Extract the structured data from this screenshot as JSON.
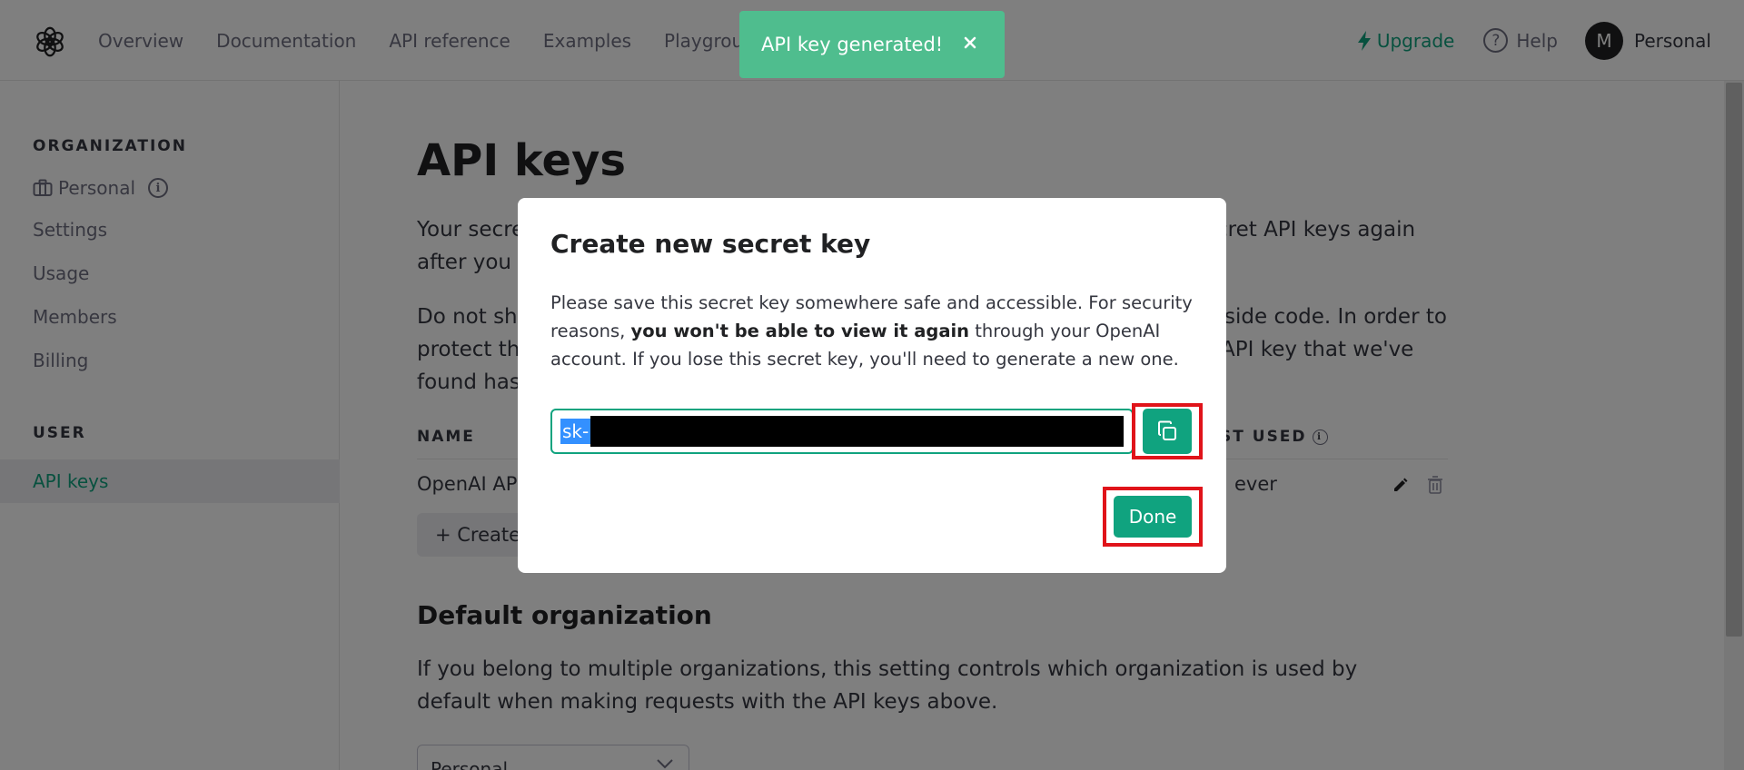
{
  "nav": {
    "links": [
      "Overview",
      "Documentation",
      "API reference",
      "Examples",
      "Playground"
    ],
    "upgrade": "Upgrade",
    "help": "Help",
    "avatar_initial": "M",
    "account": "Personal"
  },
  "sidebar": {
    "organization_heading": "ORGANIZATION",
    "org_name": "Personal",
    "items": [
      "Settings",
      "Usage",
      "Members",
      "Billing"
    ],
    "user_heading": "USER",
    "active_item": "API keys"
  },
  "main": {
    "title": "API keys",
    "para1_start": "Your secre",
    "para1_end": "cret API keys again",
    "para1_line2": "after you g",
    "para2_start": "Do not sha",
    "para2_end": "tside code. In order to",
    "para2_line2_start": "protect th",
    "para2_line2_end": "API key that we've",
    "para2_line3": "found has",
    "col_name": "NAME",
    "col_last_used": "ST USED",
    "row_name": "OpenAI AP",
    "row_last_used": "ever",
    "create_button": "+ Create",
    "default_org_title": "Default organization",
    "default_org_text": "If you belong to multiple organizations, this setting controls which organization is used by default when making requests with the API keys above.",
    "select_value": "Personal"
  },
  "modal": {
    "title": "Create new secret key",
    "body_1": "Please save this secret key somewhere safe and accessible. For security reasons, ",
    "body_bold": "you won't be able to view it again",
    "body_2": " through your OpenAI account. If you lose this secret key, you'll need to generate a new one.",
    "key_prefix": "sk-",
    "done": "Done"
  },
  "toast": {
    "message": "API key generated!"
  },
  "colors": {
    "accent": "#10a37f",
    "highlight_box": "#e0131a",
    "toast": "#4fbd8e"
  }
}
